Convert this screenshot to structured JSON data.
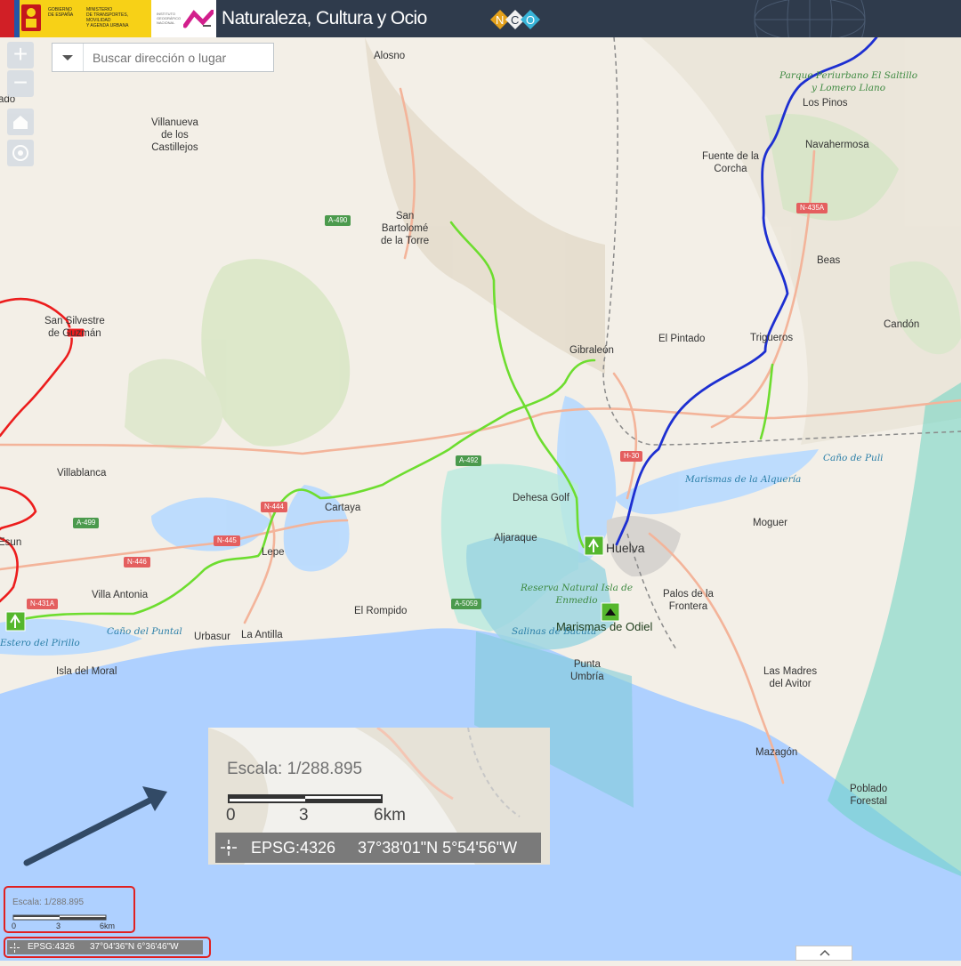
{
  "header": {
    "gov_lines": [
      "GOBIERNO",
      "DE ESPAÑA"
    ],
    "ministry_lines": [
      "MINISTERIO",
      "DE TRANSPORTES, MOVILIDAD",
      "Y AGENDA URBANA"
    ],
    "ign_lines": [
      "INSTITUTO",
      "GEOGRÁFICO",
      "NACIONAL"
    ],
    "title": "Naturaleza, Cultura y Ocio",
    "logo_letters": [
      "N",
      "C",
      "O"
    ]
  },
  "controls": {
    "zoom_in": "+",
    "zoom_out": "−",
    "search_placeholder": "Buscar dirección o lugar"
  },
  "places": [
    {
      "id": "alosno",
      "text": "Alosno"
    },
    {
      "id": "villanueva",
      "lines": [
        "Villanueva",
        "de los",
        "Castillejos"
      ]
    },
    {
      "id": "san-bartolome",
      "lines": [
        "San",
        "Bartolomé",
        "de la Torre"
      ]
    },
    {
      "id": "fuente",
      "lines": [
        "Fuente de la",
        "Corcha"
      ]
    },
    {
      "id": "los-pinos",
      "text": "Los Pinos"
    },
    {
      "id": "navahermosa",
      "text": "Navahermosa"
    },
    {
      "id": "beas",
      "text": "Beas"
    },
    {
      "id": "candon",
      "text": "Candón"
    },
    {
      "id": "el-pintado",
      "text": "El Pintado"
    },
    {
      "id": "trigueros",
      "text": "Trigueros"
    },
    {
      "id": "gibraleon",
      "text": "Gibraleón"
    },
    {
      "id": "san-silvestre",
      "lines": [
        "San Silvestre",
        "de Guzmán"
      ]
    },
    {
      "id": "villablanca",
      "text": "Villablanca"
    },
    {
      "id": "cartaya",
      "text": "Cartaya"
    },
    {
      "id": "dehesa-golf",
      "text": "Dehesa Golf"
    },
    {
      "id": "aljaraque",
      "text": "Aljaraque"
    },
    {
      "id": "huelva",
      "text": "Huelva"
    },
    {
      "id": "moguer",
      "text": "Moguer"
    },
    {
      "id": "lepe",
      "text": "Lepe"
    },
    {
      "id": "villa-antonia",
      "text": "Villa Antonia"
    },
    {
      "id": "el-rompido",
      "text": "El Rompido"
    },
    {
      "id": "urbasur",
      "text": "Urbasur"
    },
    {
      "id": "la-antilla",
      "text": "La Antilla"
    },
    {
      "id": "isla-moral",
      "text": "Isla del Moral"
    },
    {
      "id": "punta-umbria",
      "lines": [
        "Punta",
        "Umbría"
      ]
    },
    {
      "id": "palos",
      "lines": [
        "Palos de la",
        "Frontera"
      ]
    },
    {
      "id": "madres",
      "lines": [
        "Las Madres",
        "del Avitor"
      ]
    },
    {
      "id": "mazagon",
      "text": "Mazagón"
    },
    {
      "id": "poblado",
      "lines": [
        "Poblado",
        "Forestal"
      ]
    },
    {
      "id": "esun",
      "text": "Esun"
    },
    {
      "id": "ado",
      "text": "ado"
    }
  ],
  "features": {
    "parque": [
      "Parque Periurbano El Saltillo",
      "y Lomero Llano"
    ],
    "cano_puli": "Caño de Puli",
    "marismas_alqueria": "Marismas de la Alquería",
    "reserva": [
      "Reserva Natural Isla de",
      "Enmedio"
    ],
    "salinas": "Salinas de Bacuta",
    "marismas_odiel": "Marismas de Odiel",
    "estero": "Estero del Pirillo",
    "cano_puntal": "Caño del Puntal"
  },
  "roads": {
    "a490": "A-490",
    "n435a": "N-435A",
    "h30": "H-30",
    "a492": "A-492",
    "n444": "N-444",
    "n445": "N-445",
    "n446": "N-446",
    "a499": "A-499",
    "n431a": "N-431A",
    "a5059": "A-5059"
  },
  "scale": {
    "text": "Escala: 1/288.895",
    "ticks": [
      "0",
      "3",
      "6km"
    ]
  },
  "callout": {
    "scale_text": "Escala: 1/288.895",
    "ticks": [
      "0",
      "3",
      "6km"
    ],
    "epsg": "EPSG:4326",
    "coords": "37°38'01\"N 5°54'56\"W"
  },
  "status": {
    "epsg": "EPSG:4326",
    "coords": "37°04'36\"N 6°36'46\"W"
  },
  "colors": {
    "header": "#2f3b4c",
    "route_blue": "#1d2fd1",
    "route_green": "#6ddd2f",
    "route_red": "#ec1d1d",
    "highlight": "#e02020",
    "sea": "#aed0ff",
    "protected_area": "#72d8c5"
  }
}
